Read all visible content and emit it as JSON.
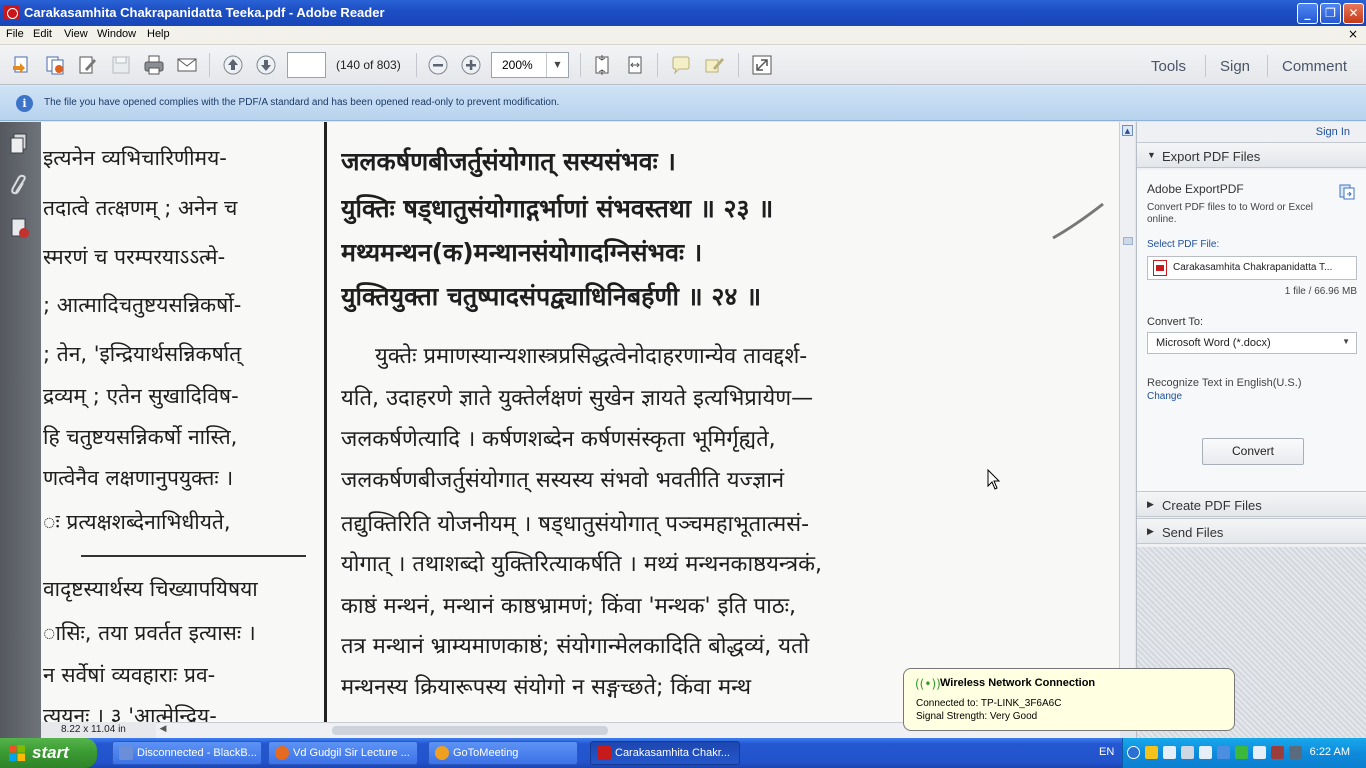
{
  "window": {
    "title": "Carakasamhita Chakrapanidatta Teeka.pdf - Adobe Reader",
    "minimize": "_",
    "restore": "❐",
    "close": "✕"
  },
  "menu": {
    "items": [
      "File",
      "Edit",
      "View",
      "Window",
      "Help"
    ],
    "close_glyph": "×"
  },
  "toolbar": {
    "page_count": "(140 of 803)",
    "zoom": "200%",
    "links": [
      "Tools",
      "Sign",
      "Comment"
    ]
  },
  "infobar": {
    "message": "The file you have opened complies with the PDF/A standard and has been opened read-only to prevent modification."
  },
  "document": {
    "left_column": [
      "इत्यनेन व्यभिचारिणीमय-",
      "तदात्वे तत्क्षणम् ; अनेन च",
      "स्मरणं च परम्परयाऽऽत्मे-",
      "; आत्मादिचतुष्टयसन्निकर्षो-",
      "; तेन, 'इन्द्रियार्थसन्निकर्षात्",
      "द्रव्यम् ; एतेन सुखादिविष-",
      "हि चतुष्टयसन्निकर्षो नास्ति,",
      "णत्वेनैव लक्षणानुपयुक्तः ।",
      "ः प्रत्यक्षशब्देनाभिधीयते,",
      "वादृष्टस्यार्थस्य चिख्यापयिषया",
      "ासिः, तया प्रवर्तत इत्यासः ।",
      "न सर्वेषां व्यवहाराः प्रव-",
      "त्ययनः । ३ 'आत्मेन्द्रिय-"
    ],
    "right_verses": [
      "जलकर्षणबीजर्तुसंयोगात् सस्यसंभवः ।",
      "युक्तिः षड्धातुसंयोगाद्गर्भाणां संभवस्तथा ॥ २३ ॥",
      "मथ्यमन्थन(क)मन्थानसंयोगादग्निसंभवः ।",
      "युक्तियुक्ता चतुष्पादसंपद्व्याधिनिबर्हणी ॥ २४ ॥"
    ],
    "right_commentary": [
      "युक्तेः प्रमाणस्यान्यशास्त्रप्रसिद्धत्वेनोदाहरणान्येव तावद्दर्श-",
      "यति, उदाहरणे ज्ञाते युक्तेर्लक्षणं सुखेन ज्ञायते इत्यभिप्रायेण—",
      "जलकर्षणेत्यादि । कर्षणशब्देन कर्षणसंस्कृता भूमिर्गृह्यते,",
      "जलकर्षणबीजर्तुसंयोगात् सस्यस्य संभवो भवतीति यज्ज्ञानं",
      "तद्युक्तिरिति योजनीयम् । षड्धातुसंयोगात् पञ्चमहाभूतात्मसं-",
      "योगात् । तथाशब्दो युक्तिरित्याकर्षति । मथ्यं मन्थनकाष्ठयन्त्रकं,",
      "काष्ठं मन्थनं, मन्थानं काष्ठभ्रामणं; किंवा 'मन्थक' इति पाठः,",
      "तत्र मन्थानं भ्राम्यमाणकाष्ठं; संयोगान्मेलकादिति बोद्धव्यं, यतो",
      "मन्थनस्य क्रियारूपस्य संयोगो न सङ्गच्छते; किंवा मन्थ"
    ],
    "size_label": "8.22 x 11.04 in"
  },
  "right_panel": {
    "sign_in": "Sign In",
    "export_header": "Export PDF Files",
    "export_title": "Adobe ExportPDF",
    "export_desc": "Convert PDF files to to Word or Excel online.",
    "select_label": "Select PDF File:",
    "file_name": "Carakasamhita Chakrapanidatta T...",
    "file_size": "1 file / 66.96 MB",
    "convert_to_label": "Convert To:",
    "convert_to_value": "Microsoft Word (*.docx)",
    "recognize": "Recognize Text in English(U.S.)",
    "change": "Change",
    "convert_button": "Convert",
    "create_header": "Create PDF Files",
    "send_header": "Send Files"
  },
  "balloon": {
    "title": "Wireless Network Connection",
    "line1": "Connected to: TP-LINK_3F6A6C",
    "line2": "Signal Strength: Very Good"
  },
  "taskbar": {
    "start": "start",
    "tasks": [
      {
        "label": "Disconnected - BlackB...",
        "color": "#6a8fd8"
      },
      {
        "label": "Vd Gudgil Sir Lecture ...",
        "color": "#e66a1f"
      },
      {
        "label": "GoToMeeting",
        "color": "#f0a020"
      },
      {
        "label": "Carakasamhita Chakr...",
        "color": "#c71a1a"
      }
    ],
    "lang": "EN",
    "clock": "6:22 AM"
  }
}
